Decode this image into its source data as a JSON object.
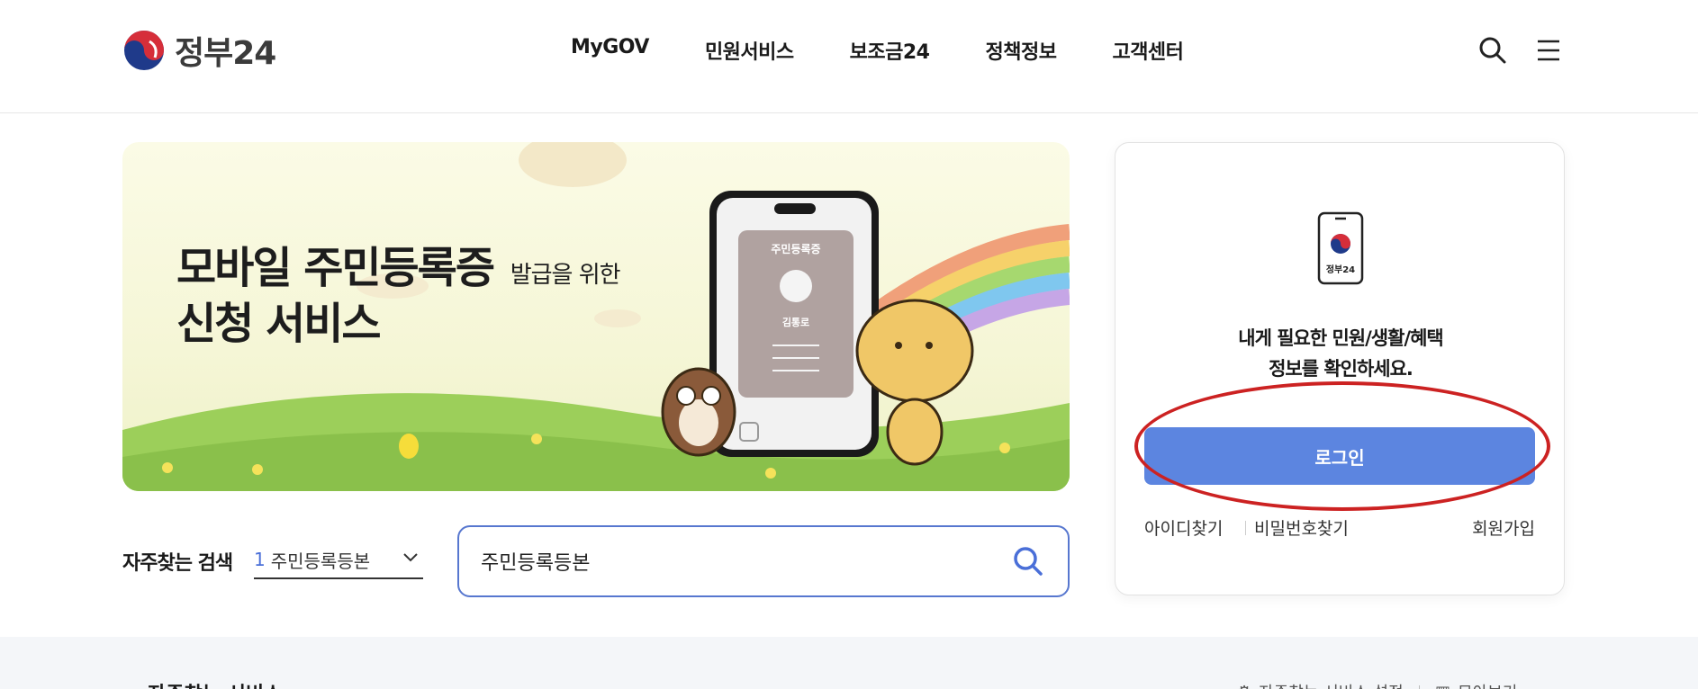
{
  "header": {
    "logo_text": "정부24",
    "nav": [
      "MyGOV",
      "민원서비스",
      "보조금24",
      "정책정보",
      "고객센터"
    ],
    "icons": [
      "search-icon",
      "menu-icon"
    ]
  },
  "banner": {
    "title_main": "모바일 주민등록증",
    "title_suffix": "발급을 위한",
    "title_line2": "신청 서비스",
    "card_label": "주민등록증",
    "card_name": "김통로"
  },
  "search": {
    "freq_label": "자주찾는 검색",
    "freq_rank": "1",
    "freq_term": "주민등록등본",
    "input_value": "주민등록등본"
  },
  "login": {
    "icon_label": "정부24",
    "message_line1": "내게 필요한 민원/생활/혜택",
    "message_line2": "정보를 확인하세요.",
    "button_label": "로그인",
    "find_id": "아이디찾기",
    "find_password": "비밀번호찾기",
    "signup": "회원가입"
  },
  "bottom": {
    "title": "자주찾는 서비스",
    "setting_label": "자주찾는 서비스 설정",
    "more_label": "모아보기"
  },
  "colors": {
    "accent": "#5c85e0",
    "search_border": "#5777cf",
    "annotation": "#cc2222"
  }
}
